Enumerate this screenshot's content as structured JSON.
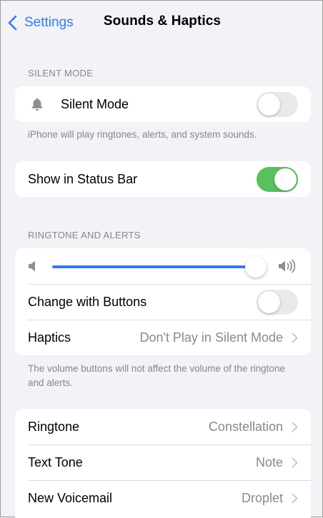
{
  "nav": {
    "back_label": "Settings",
    "title": "Sounds & Haptics"
  },
  "silent_section": {
    "header": "SILENT MODE",
    "silent_mode_label": "Silent Mode",
    "silent_mode_on": false,
    "footer": "iPhone will play ringtones, alerts, and system sounds."
  },
  "status_bar": {
    "label": "Show in Status Bar",
    "on": true
  },
  "ringtone_section": {
    "header": "RINGTONE AND ALERTS",
    "volume_level": 0.95,
    "change_with_buttons_label": "Change with Buttons",
    "change_with_buttons_on": false,
    "haptics_label": "Haptics",
    "haptics_value": "Don't Play in Silent Mode",
    "footer": "The volume buttons will not affect the volume of the ringtone and alerts."
  },
  "tones": [
    {
      "label": "Ringtone",
      "value": "Constellation"
    },
    {
      "label": "Text Tone",
      "value": "Note"
    },
    {
      "label": "New Voicemail",
      "value": "Droplet"
    }
  ],
  "colors": {
    "accent": "#2f7cf6",
    "toggle_on": "#5ac05f",
    "slider_fill": "#3478f6",
    "background": "#f2f2f7"
  }
}
